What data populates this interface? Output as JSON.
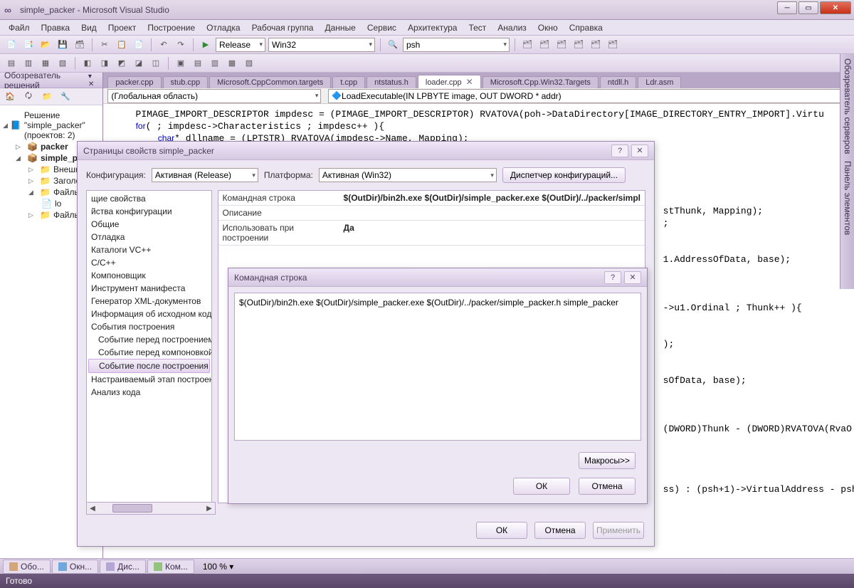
{
  "window": {
    "title": "simple_packer - Microsoft Visual Studio"
  },
  "menu": [
    "Файл",
    "Правка",
    "Вид",
    "Проект",
    "Построение",
    "Отладка",
    "Рабочая группа",
    "Данные",
    "Сервис",
    "Архитектура",
    "Тест",
    "Анализ",
    "Окно",
    "Справка"
  ],
  "toolbar1": {
    "config_combo": "Release",
    "platform_combo": "Win32",
    "search_box": "psh"
  },
  "solution_explorer": {
    "title": "Обозреватель решений",
    "root": "Решение \"simple_packer\" (проектов: 2)",
    "projects": [
      {
        "name": "packer",
        "bold": true
      },
      {
        "name": "simple_packer",
        "bold": true,
        "children": [
          "Внешн",
          "Заголо",
          "Файль",
          "lo",
          "Файль"
        ]
      }
    ]
  },
  "editor": {
    "tabs": [
      "packer.cpp",
      "stub.cpp",
      "Microsoft.CppCommon.targets",
      "t.cpp",
      "ntstatus.h",
      "loader.cpp",
      "Microsoft.Cpp.Win32.Targets",
      "ntdll.h",
      "Ldr.asm"
    ],
    "active_tab_index": 5,
    "nav_left": "(Глобальная область)",
    "nav_right": "LoadExecutable(IN LPBYTE image, OUT DWORD * addr)",
    "code_lines": [
      "    PIMAGE_IMPORT_DESCRIPTOR impdesc = (PIMAGE_IMPORT_DESCRIPTOR) RVATOVA(poh->DataDirectory[IMAGE_DIRECTORY_ENTRY_IMPORT].Virtu",
      "    for( ; impdesc->Characteristics ; impdesc++ ){",
      "        char* dllname = (LPTSTR) RVATOVA(impdesc->Name, Mapping);",
      "",
      "",
      "",
      "",
      "",
      "                                                                                                   stThunk, Mapping);",
      "                                                                                                   ;",
      "",
      "",
      "                                                                                                   1.AddressOfData, base);",
      "",
      "",
      "",
      "                                                                                                   ->u1.Ordinal ; Thunk++ ){",
      "",
      "",
      "                                                                                                   );",
      "",
      "",
      "                                                                                                   sOfData, base);",
      "",
      "",
      "",
      "                                                                                                   (DWORD)Thunk - (DWORD)RVATOVA(RvaO",
      "",
      "",
      "",
      "",
      "                                                                                                   ss) : (psh+1)->VirtualAddress - psh"
    ]
  },
  "vertical_tools": [
    "Обозреватель серверов",
    "Панель элементов"
  ],
  "dlg_props": {
    "title": "Страницы свойств simple_packer",
    "cfg_label": "Конфигурация:",
    "cfg_value": "Активная (Release)",
    "plat_label": "Платформа:",
    "plat_value": "Активная (Win32)",
    "disp_btn": "Диспетчер конфигураций...",
    "tree": [
      "щие свойства",
      "йства конфигурации",
      "Общие",
      "Отладка",
      "Каталоги VC++",
      "C/C++",
      "Компоновщик",
      "Инструмент манифеста",
      "Генератор XML-документов",
      "Информация об исходном коде",
      "События построения",
      "  Событие перед построением",
      "  Событие перед компоновкой",
      "  Событие после построения",
      "Настраиваемый этап построения",
      "Анализ кода"
    ],
    "tree_selected_index": 13,
    "rows": [
      {
        "k": "Командная строка",
        "v": "$(OutDir)/bin2h.exe $(OutDir)/simple_packer.exe $(OutDir)/../packer/simpl"
      },
      {
        "k": "Описание",
        "v": ""
      },
      {
        "k": "Использовать при построении",
        "v": "Да"
      }
    ],
    "ok": "ОК",
    "cancel": "Отмена",
    "apply": "Применить"
  },
  "dlg_cmd": {
    "title": "Командная строка",
    "text": "$(OutDir)/bin2h.exe $(OutDir)/simple_packer.exe $(OutDir)/../packer/simple_packer.h simple_packer",
    "macros": "Макросы>>",
    "ok": "ОК",
    "cancel": "Отмена"
  },
  "bottom_tabs": [
    "Обо...",
    "Окн...",
    "Дис...",
    "Ком..."
  ],
  "zoom": "100 %",
  "status": "Готово"
}
